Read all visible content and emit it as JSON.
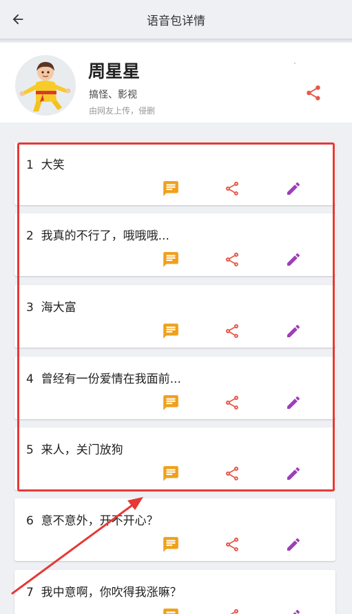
{
  "topbar": {
    "title": "语音包详情"
  },
  "pack": {
    "name": "周星星",
    "tags": "搞怪、影视",
    "note": "由网友上传，侵删"
  },
  "items": [
    {
      "index": "1",
      "title": "大笑"
    },
    {
      "index": "2",
      "title": "我真的不行了，哦哦哦..."
    },
    {
      "index": "3",
      "title": "海大富"
    },
    {
      "index": "4",
      "title": "曾经有一份爱情在我面前..."
    },
    {
      "index": "5",
      "title": "来人，关门放狗"
    },
    {
      "index": "6",
      "title": "意不意外，开不开心？"
    },
    {
      "index": "7",
      "title": "我中意啊，你吹得我涨嘛？"
    }
  ],
  "colors": {
    "message": "#f0a01c",
    "share": "#e8574b",
    "edit": "#9c3fb8",
    "highlight": "#e53935"
  },
  "icons": [
    "back-arrow-icon",
    "share-icon",
    "message-icon",
    "edit-icon"
  ]
}
